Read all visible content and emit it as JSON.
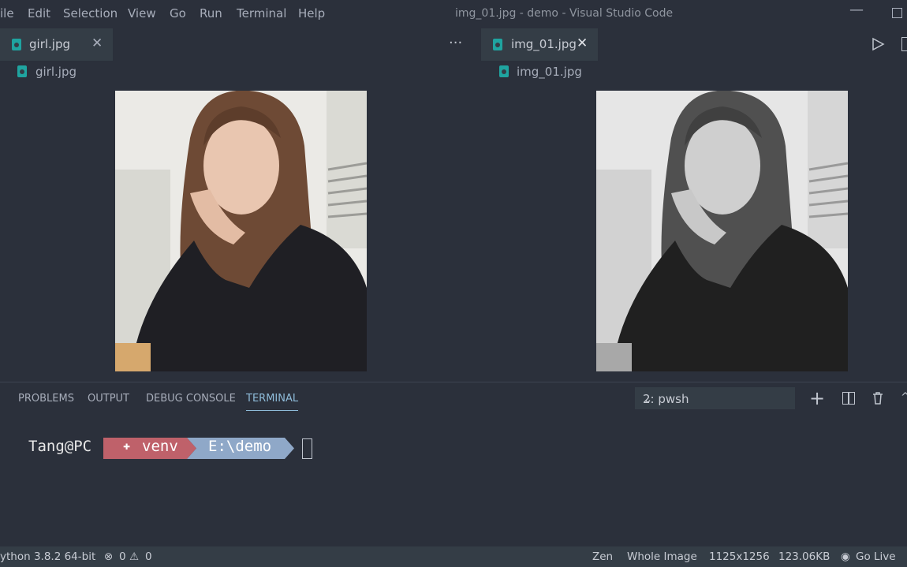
{
  "menu": {
    "items": [
      "ile",
      "Edit",
      "Selection",
      "View",
      "Go",
      "Run",
      "Terminal",
      "Help"
    ],
    "window_title": "img_01.jpg - demo - Visual Studio Code"
  },
  "editor_left": {
    "tab_label": "girl.jpg",
    "breadcrumb": "girl.jpg",
    "image_mode": "color"
  },
  "editor_right": {
    "tab_label": "img_01.jpg",
    "breadcrumb": "img_01.jpg",
    "image_mode": "grayscale"
  },
  "panel": {
    "tabs": [
      "PROBLEMS",
      "OUTPUT",
      "DEBUG CONSOLE",
      "TERMINAL"
    ],
    "active_tab": "TERMINAL",
    "terminal_select": "2: pwsh"
  },
  "terminal": {
    "user_host": "Tang@PC",
    "venv_label": "venv",
    "path": "E:\\demo",
    "venv_color": "#bf616a",
    "path_color": "#8fa8c8"
  },
  "statusbar": {
    "python": "ython 3.8.2 64-bit",
    "errors": "0",
    "warnings": "0",
    "zen": "Zen",
    "whole_image": "Whole Image",
    "dimensions": "1125x1256",
    "file_size": "123.06KB",
    "go_live": "Go Live"
  },
  "colors": {
    "background": "#2b303b",
    "tab_background": "#343d46",
    "accent": "#8fbcda",
    "file_icon": "#1fa4a0"
  }
}
